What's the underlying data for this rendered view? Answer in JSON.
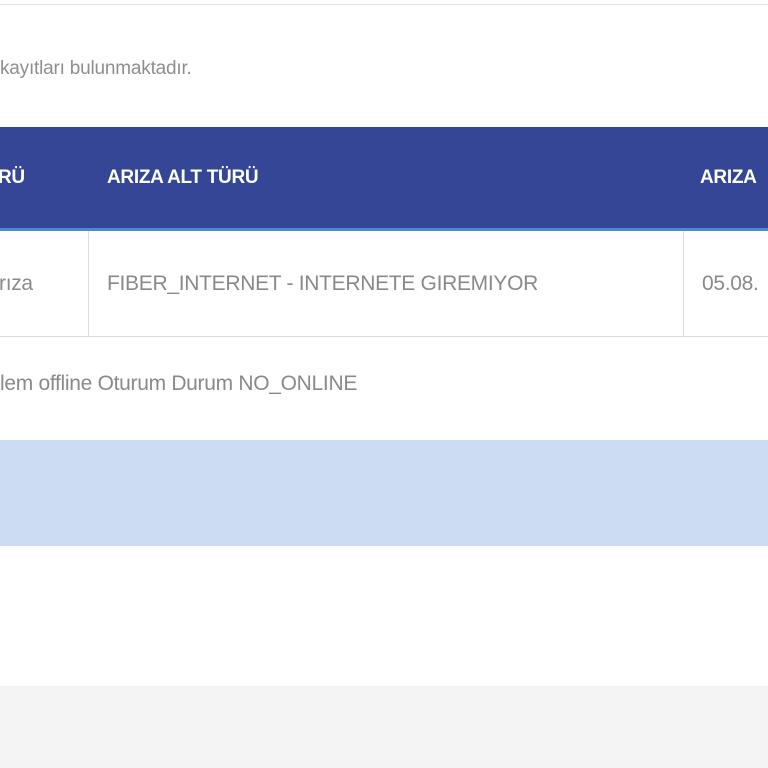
{
  "info": {
    "text": "kayıtları bulunmaktadır."
  },
  "table": {
    "headers": [
      {
        "label": "RÜ"
      },
      {
        "label": "ARIZA ALT TÜRÜ"
      },
      {
        "label": "ARIZA"
      }
    ],
    "rows": [
      {
        "cells": [
          "rıza",
          "FIBER_INTERNET - INTERNETE GIREMIYOR",
          "05.08."
        ]
      }
    ]
  },
  "detail": {
    "text": "lem offline Oturum Durum NO_ONLINE"
  },
  "colors": {
    "header_bg": "#344695",
    "header_accent": "#4a8ad8",
    "band_bg": "#cbdcf3",
    "text_muted": "#8a8a8a"
  }
}
